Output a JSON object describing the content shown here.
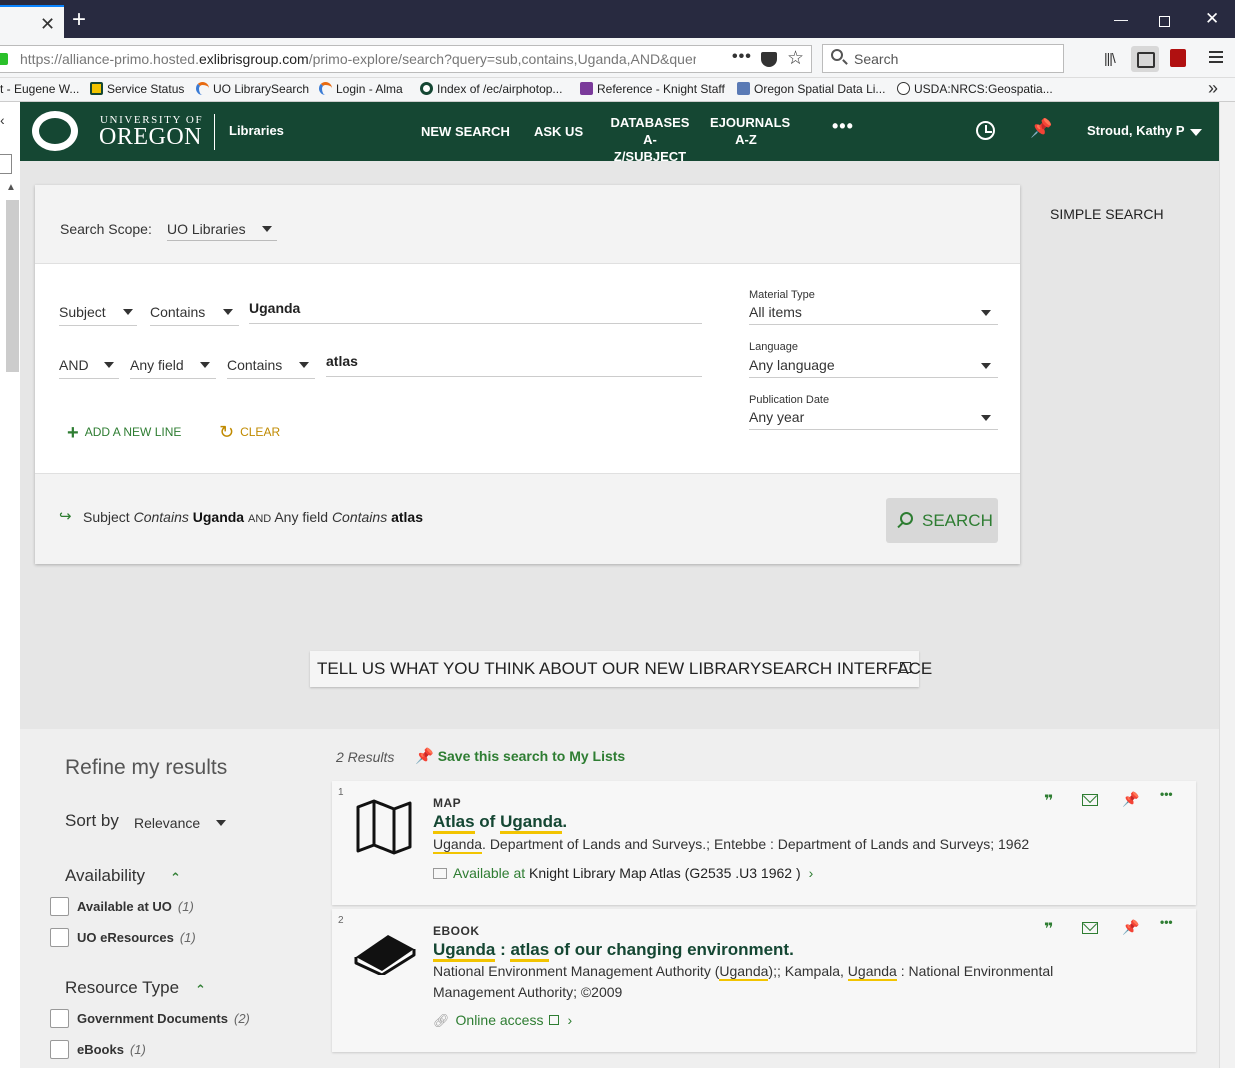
{
  "browser": {
    "url": "https://alliance-primo.hosted.exlibrisgroup.com/primo-explore/search?query=sub,contains,Uganda,AND&query",
    "url_host_pre": "https://alliance-primo.hosted.",
    "url_host": "exlibrisgroup.com",
    "url_path": "/primo-explore/search?query=sub,contains,Uganda,AND&query",
    "search_placeholder": "Search",
    "bookmarks": [
      "t - Eugene W...",
      "Service Status",
      "UO LibrarySearch",
      "Login - Alma",
      "Index of /ec/airphotop...",
      "Reference - Knight Staff",
      "Oregon Spatial Data Li...",
      "USDA:NRCS:Geospatia..."
    ]
  },
  "header": {
    "logo_top": "UNIVERSITY OF",
    "logo_bottom": "OREGON",
    "libraries": "Libraries",
    "nav": {
      "new_search": "NEW SEARCH",
      "ask_us": "ASK US",
      "databases_l1": "DATABASES",
      "databases_l2": "A-Z/SUBJECT",
      "ejournals_l1": "EJOURNALS",
      "ejournals_l2": "A-Z",
      "more": "•••"
    },
    "user": "Stroud, Kathy P"
  },
  "search": {
    "scope_label": "Search Scope:",
    "scope_value": "UO Libraries",
    "line1": {
      "field": "Subject",
      "operator": "Contains",
      "value": "Uganda"
    },
    "line2": {
      "boolean": "AND",
      "field": "Any field",
      "operator": "Contains",
      "value": "atlas"
    },
    "material_type_label": "Material Type",
    "material_type_value": "All items",
    "language_label": "Language",
    "language_value": "Any language",
    "pub_date_label": "Publication Date",
    "pub_date_value": "Any year",
    "add_line": "ADD A NEW LINE",
    "clear": "CLEAR",
    "summary": {
      "f1": "Subject",
      "op1": "Contains",
      "v1": "Uganda",
      "bool": "AND",
      "f2": "Any field",
      "op2": "Contains",
      "v2": "atlas"
    },
    "search_button": "SEARCH",
    "simple_search": "SIMPLE SEARCH"
  },
  "feedback": "TELL US WHAT YOU THINK ABOUT OUR NEW LIBRARYSEARCH INTERFACE",
  "refine": {
    "title": "Refine my results",
    "sort_label": "Sort by",
    "sort_value": "Relevance",
    "availability_title": "Availability",
    "availability": [
      {
        "label": "Available at UO",
        "count": "(1)"
      },
      {
        "label": "UO eResources",
        "count": "(1)"
      }
    ],
    "resource_type_title": "Resource Type",
    "resource_type": [
      {
        "label": "Government Documents",
        "count": "(2)"
      },
      {
        "label": "eBooks",
        "count": "(1)"
      }
    ]
  },
  "results": {
    "count": "2 Results",
    "save": "Save this search to My Lists",
    "items": [
      {
        "num": "1",
        "type": "MAP",
        "title_a": "Atlas",
        "title_b": " of ",
        "title_c": "Uganda",
        "title_d": ".",
        "detail_hl": "Uganda",
        "detail": ". Department of Lands and Surveys.; Entebbe : Department of Lands and Surveys; 1962",
        "avail": "Available at",
        "location": "Knight Library  Map Atlas (G2535 .U3 1962 )"
      },
      {
        "num": "2",
        "type": "EBOOK",
        "title_a": "Uganda",
        "title_b": " : ",
        "title_c": "atlas",
        "title_d": " of our changing environment.",
        "detail_1": "National Environment Management Authority (",
        "detail_hl1": "Uganda",
        "detail_2": ");; Kampala, ",
        "detail_hl2": "Uganda",
        "detail_3": " : National Environmental",
        "detail_line2": "Management Authority; ©2009",
        "access": "Online access"
      }
    ]
  },
  "icons": {
    "quote": "❞",
    "more": "•••",
    "chevron_up": "⌃",
    "chevron_right": "›"
  },
  "colors": {
    "uo_green": "#154733",
    "accent_green": "#2e7d32",
    "highlight": "#f2c400"
  }
}
